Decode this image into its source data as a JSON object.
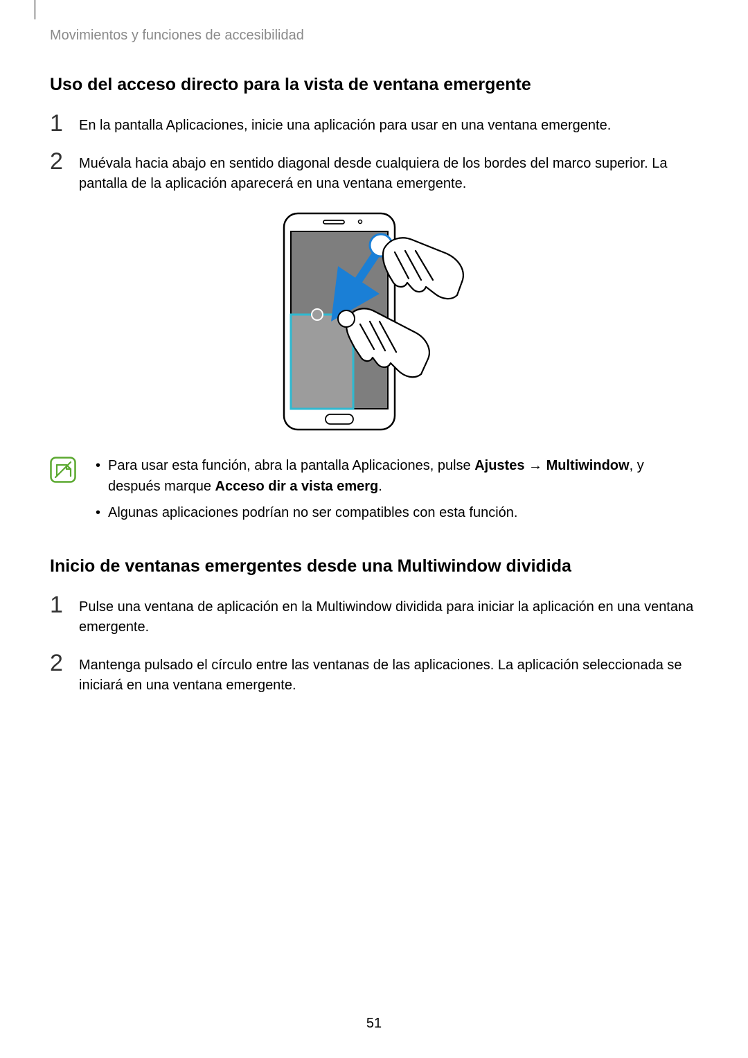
{
  "breadcrumb": "Movimientos y funciones de accesibilidad",
  "section1": {
    "heading": "Uso del acceso directo para la vista de ventana emergente",
    "step1_num": "1",
    "step1_text": "En la pantalla Aplicaciones, inicie una aplicación para usar en una ventana emergente.",
    "step2_num": "2",
    "step2_text": "Muévala hacia abajo en sentido diagonal desde cualquiera de los bordes del marco superior. La pantalla de la aplicación aparecerá en una ventana emergente."
  },
  "note": {
    "item1_pre": "Para usar esta función, abra la pantalla Aplicaciones, pulse ",
    "item1_b1": "Ajustes",
    "item1_arrow": " → ",
    "item1_b2": "Multiwindow",
    "item1_mid": ", y después marque ",
    "item1_b3": "Acceso dir a vista emerg",
    "item1_post": ".",
    "item2": "Algunas aplicaciones podrían no ser compatibles con esta función."
  },
  "section2": {
    "heading": "Inicio de ventanas emergentes desde una Multiwindow dividida",
    "step1_num": "1",
    "step1_text": "Pulse una ventana de aplicación en la Multiwindow dividida para iniciar la aplicación en una ventana emergente.",
    "step2_num": "2",
    "step2_text": "Mantenga pulsado el círculo entre las ventanas de las aplicaciones. La aplicación seleccionada se iniciará en una ventana emergente."
  },
  "page_number": "51"
}
